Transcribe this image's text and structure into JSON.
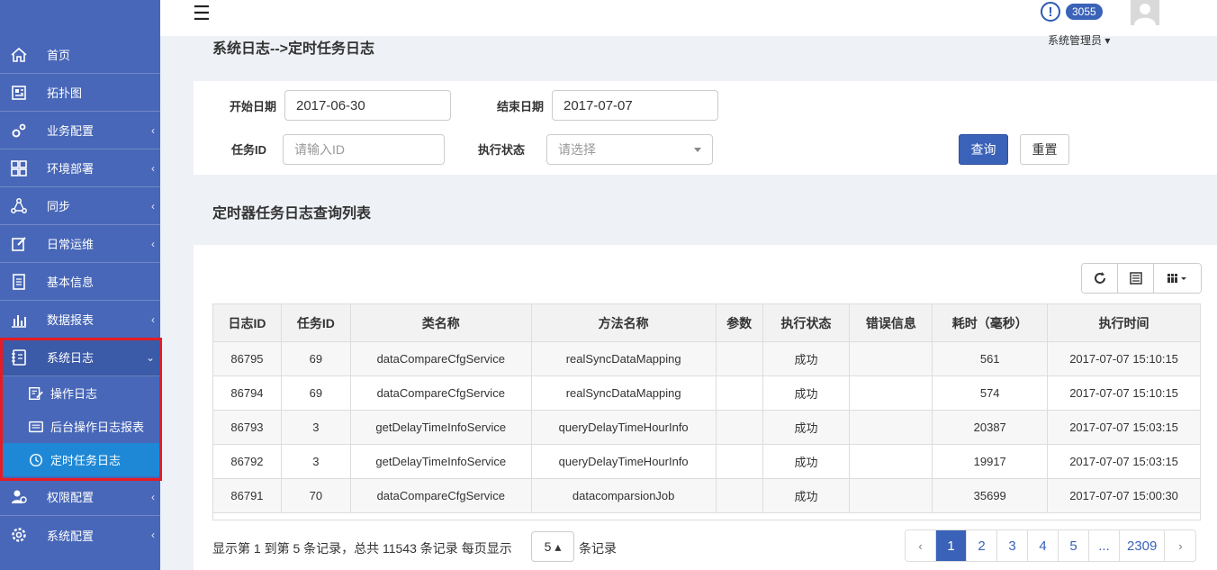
{
  "sidebar": {
    "items": [
      {
        "label": "首页",
        "icon": "home-icon",
        "chevron": ""
      },
      {
        "label": "拓扑图",
        "icon": "topology-icon",
        "chevron": ""
      },
      {
        "label": "业务配置",
        "icon": "gears-icon",
        "chevron": "‹"
      },
      {
        "label": "环境部署",
        "icon": "grid-icon",
        "chevron": "‹"
      },
      {
        "label": "同步",
        "icon": "network-icon",
        "chevron": "‹"
      },
      {
        "label": "日常运维",
        "icon": "edit-icon",
        "chevron": "‹"
      },
      {
        "label": "基本信息",
        "icon": "document-icon",
        "chevron": ""
      },
      {
        "label": "数据报表",
        "icon": "bar-chart-icon",
        "chevron": "‹"
      },
      {
        "label": "系统日志",
        "icon": "log-icon",
        "chevron": "⌄"
      },
      {
        "label": "权限配置",
        "icon": "users-icon",
        "chevron": "‹"
      },
      {
        "label": "系统配置",
        "icon": "cog-icon",
        "chevron": "‹"
      }
    ],
    "sub_items": [
      {
        "label": "操作日志",
        "icon": "pen-doc-icon"
      },
      {
        "label": "后台操作日志报表",
        "icon": "report-icon"
      },
      {
        "label": "定时任务日志",
        "icon": "clock-icon"
      }
    ],
    "highlight_color": "#e51c23"
  },
  "topbar": {
    "alert_count": "3055",
    "user_name": "系统管理员 ▾"
  },
  "breadcrumb": "系统日志-->定时任务日志",
  "filters": {
    "start_label": "开始日期",
    "start_value": "2017-06-30",
    "end_label": "结束日期",
    "end_value": "2017-07-07",
    "task_id_label": "任务ID",
    "task_id_placeholder": "请输入ID",
    "status_label": "执行状态",
    "status_placeholder": "请选择",
    "query_button": "查询",
    "reset_button": "重置"
  },
  "table": {
    "title": "定时器任务日志查询列表",
    "columns": [
      "日志ID",
      "任务ID",
      "类名称",
      "方法名称",
      "参数",
      "执行状态",
      "错误信息",
      "耗时（毫秒）",
      "执行时间"
    ],
    "rows": [
      [
        "86795",
        "69",
        "dataCompareCfgService",
        "realSyncDataMapping",
        "",
        "成功",
        "",
        "561",
        "2017-07-07 15:10:15"
      ],
      [
        "86794",
        "69",
        "dataCompareCfgService",
        "realSyncDataMapping",
        "",
        "成功",
        "",
        "574",
        "2017-07-07 15:10:15"
      ],
      [
        "86793",
        "3",
        "getDelayTimeInfoService",
        "queryDelayTimeHourInfo",
        "",
        "成功",
        "",
        "20387",
        "2017-07-07 15:03:15"
      ],
      [
        "86792",
        "3",
        "getDelayTimeInfoService",
        "queryDelayTimeHourInfo",
        "",
        "成功",
        "",
        "19917",
        "2017-07-07 15:03:15"
      ],
      [
        "86791",
        "70",
        "dataCompareCfgService",
        "datacomparsionJob",
        "",
        "成功",
        "",
        "35699",
        "2017-07-07 15:00:30"
      ]
    ]
  },
  "pager": {
    "info": "显示第 1 到第 5 条记录，总共 11543 条记录 每页显示",
    "page_size": "5 ▴",
    "suffix": "条记录",
    "prev": "‹",
    "pages": [
      "1",
      "2",
      "3",
      "4",
      "5",
      "...",
      "2309"
    ],
    "next": "›",
    "active_page": "1"
  },
  "colors": {
    "sidebar_bg": "#4867b8",
    "active_sub_bg": "#1e88d6",
    "primary": "#3a62b8"
  }
}
